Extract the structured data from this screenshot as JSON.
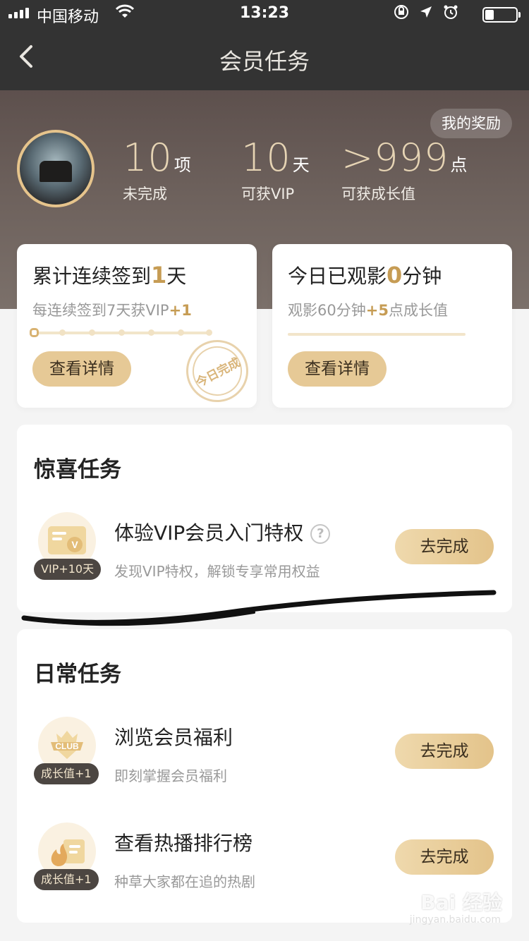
{
  "status_bar": {
    "carrier": "中国移动",
    "time": "13:23"
  },
  "nav": {
    "title": "会员任务"
  },
  "header": {
    "reward_button": "我的奖励",
    "stats": [
      {
        "value": "10",
        "unit": "项",
        "label": "未完成"
      },
      {
        "value": "10",
        "unit": "天",
        "label": "可获VIP"
      },
      {
        "value": ">999",
        "unit": "点",
        "label": "可获成长值"
      }
    ]
  },
  "checkin": {
    "title_prefix": "累计连续签到",
    "days": "1",
    "title_suffix": "天",
    "subtitle_prefix": "每连续签到7天获VIP",
    "subtitle_bonus": "+1",
    "button": "查看详情",
    "stamp": "今日完成"
  },
  "watch": {
    "title_prefix": "今日已观影",
    "minutes": "0",
    "title_suffix": "分钟",
    "subtitle_prefix": "观影60分钟",
    "subtitle_bonus": "+5",
    "subtitle_suffix": "点成长值",
    "button": "查看详情"
  },
  "surprise_tasks": {
    "title": "惊喜任务",
    "items": [
      {
        "name": "体验VIP会员入门特权",
        "help": "?",
        "desc": "发现VIP特权，解锁专享常用权益",
        "badge": "VIP+10天",
        "button": "去完成",
        "icon": "vip-card-icon"
      }
    ]
  },
  "daily_tasks": {
    "title": "日常任务",
    "items": [
      {
        "name": "浏览会员福利",
        "desc": "即刻掌握会员福利",
        "badge": "成长值+1",
        "button": "去完成",
        "icon": "club-crown-icon",
        "icon_text": "CLUB"
      },
      {
        "name": "查看热播排行榜",
        "desc": "种草大家都在追的热剧",
        "badge": "成长值+1",
        "button": "去完成",
        "icon": "hot-list-icon"
      }
    ]
  },
  "watermark": {
    "text": "Bai 经验",
    "sub": "jingyan.baidu.com"
  },
  "colors": {
    "gold": "#c69c54",
    "button": "#e6c996",
    "header_dark": "#333333"
  }
}
